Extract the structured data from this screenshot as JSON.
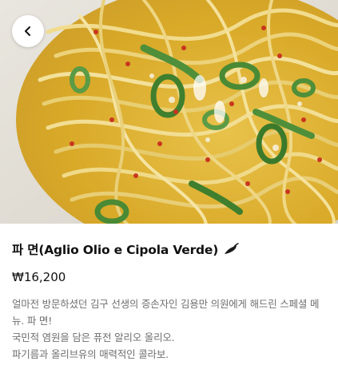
{
  "header": {
    "back_icon": "chevron-left-icon"
  },
  "hero": {
    "image_semantic": "spaghetti-with-green-onion-photo"
  },
  "menu_item": {
    "name": "파 면(Aglio Olio e Cipola Verde)",
    "spicy_icon": "chili-pepper-icon",
    "price": "₩16,200",
    "description": [
      "얼마전 방문하셨던 김구 선생의 증손자인 김용만 의원에게 해드린 스페셜 메뉴. 파 면!",
      "국민적 염원을 담은 퓨전 알리오 올리오.",
      "파기름과 올리브유의 매력적인 콜라보."
    ]
  },
  "colors": {
    "title": "#111111",
    "description": "#6f6f6f",
    "chili": "#1a1a1a"
  }
}
